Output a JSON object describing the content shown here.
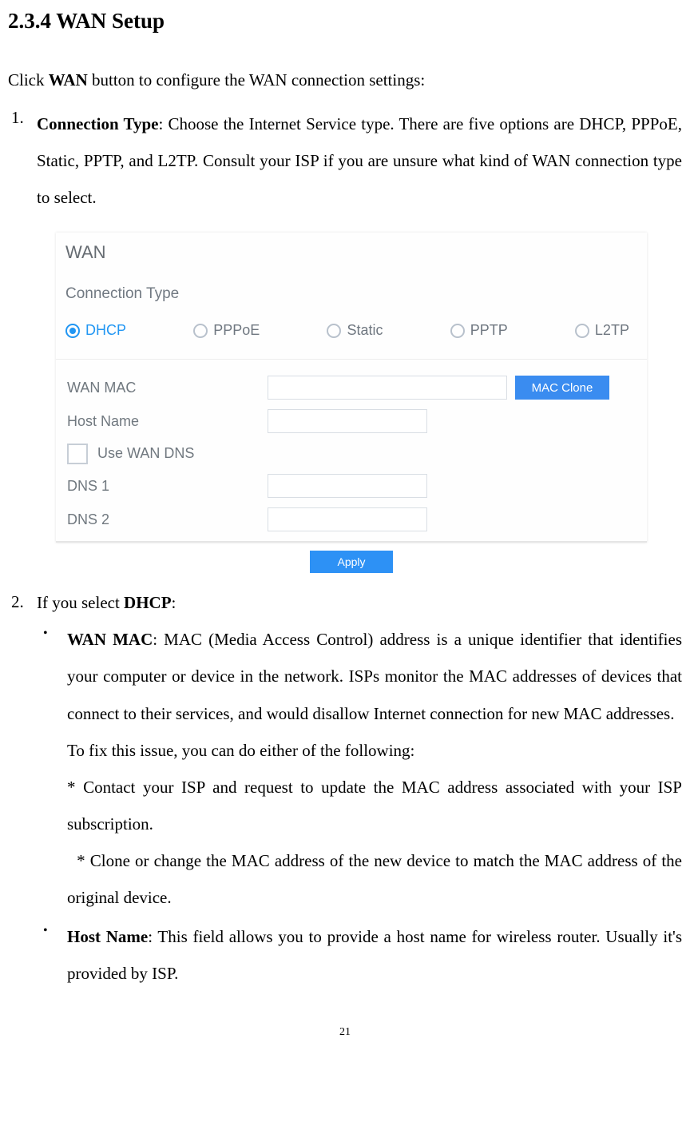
{
  "heading": "2.3.4 WAN Setup",
  "intro_before": "Click ",
  "intro_bold": "WAN",
  "intro_after": " button to configure the WAN connection settings:",
  "item1_num": "1.",
  "item1_bold": "Connection Type",
  "item1_text": ": Choose the Internet Service type. There are five options are DHCP, PPPoE, Static, PPTP, and L2TP. Consult your ISP if you are unsure what kind of WAN connection type to select.",
  "shot": {
    "title": "WAN",
    "subtitle": "Connection Type",
    "opts": {
      "dhcp": "DHCP",
      "pppoe": "PPPoE",
      "static": "Static",
      "pptp": "PPTP",
      "l2tp": "L2TP"
    },
    "labels": {
      "wan_mac": "WAN MAC",
      "host_name": "Host Name",
      "use_wan_dns": "Use WAN DNS",
      "dns1": "DNS 1",
      "dns2": "DNS 2"
    },
    "mac_clone": "MAC Clone",
    "apply": "Apply"
  },
  "item2_num": "2.",
  "item2_before": "If you select ",
  "item2_bold": "DHCP",
  "item2_after": ":",
  "bullet_wanmac_bold": "WAN MAC",
  "bullet_wanmac_p1": ": MAC (Media Access Control) address is a unique identifier that identifies your computer or device in the network. ISPs monitor the MAC addresses of devices that connect to their services, and would disallow Internet connection for new MAC addresses.",
  "bullet_wanmac_p2": "To fix this issue, you can do either of the following:",
  "bullet_wanmac_p3": "* Contact your ISP and request to update the MAC address associated with your ISP subscription.",
  "bullet_wanmac_p4": "  * Clone or change the MAC address of the new device to match the MAC address of the original device.",
  "bullet_hostname_bold": "Host Name",
  "bullet_hostname_text": ": This field allows you to provide a host name for wireless router. Usually it's provided by ISP.",
  "page_number": "21"
}
